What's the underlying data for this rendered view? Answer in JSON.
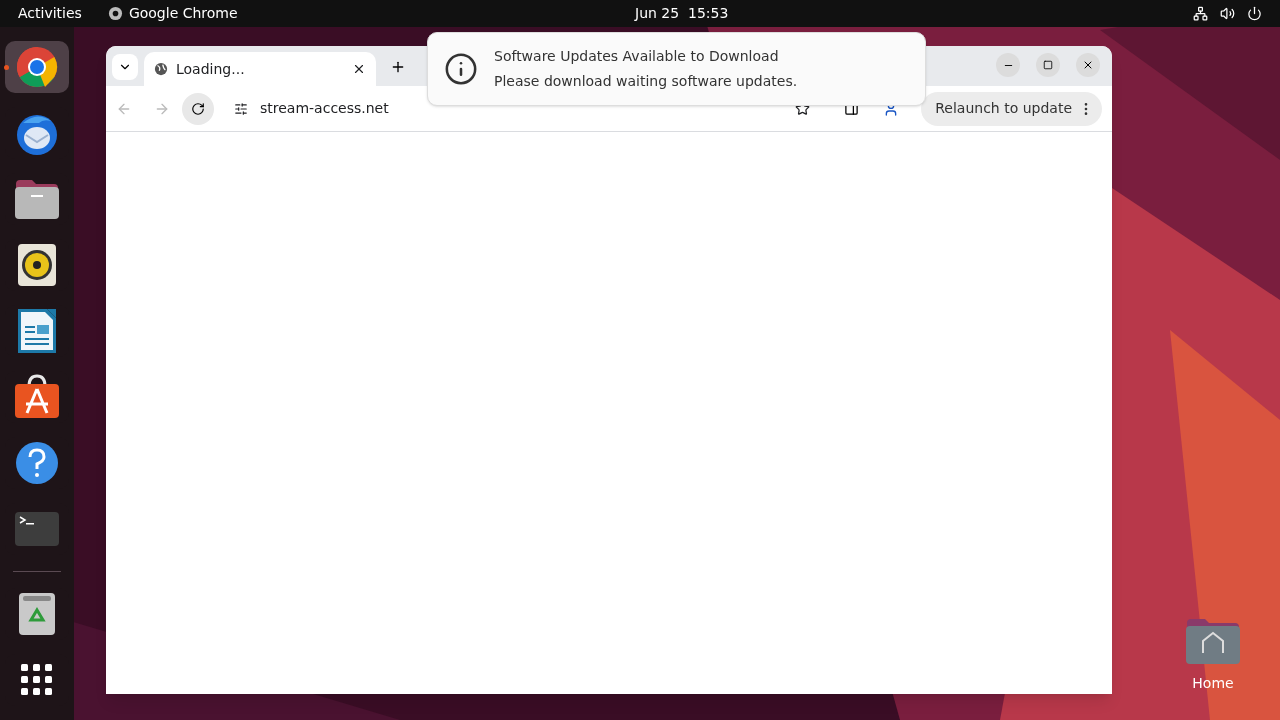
{
  "top_bar": {
    "activities": "Activities",
    "app_name": "Google Chrome",
    "clock": "Jun 25  15:53"
  },
  "dock": {
    "items": [
      {
        "kind": "chrome",
        "selected": true
      },
      {
        "kind": "mail",
        "selected": false
      },
      {
        "kind": "files",
        "selected": false
      },
      {
        "kind": "music",
        "selected": false
      },
      {
        "kind": "writer",
        "selected": false
      },
      {
        "kind": "store",
        "selected": false
      },
      {
        "kind": "help",
        "selected": false
      },
      {
        "kind": "terminal",
        "selected": false
      }
    ],
    "bottom_items": [
      {
        "kind": "trash",
        "selected": false
      },
      {
        "kind": "apps",
        "selected": false
      }
    ]
  },
  "browser": {
    "tabs": [
      {
        "title": "Loading...",
        "selected": true
      }
    ],
    "address": "stream-access.net",
    "relaunch_button": "Relaunch to update"
  },
  "notification": {
    "title": "Software Updates Available to Download",
    "body": "Please download waiting software updates."
  },
  "desktop_icons": [
    {
      "label": "Home"
    }
  ]
}
